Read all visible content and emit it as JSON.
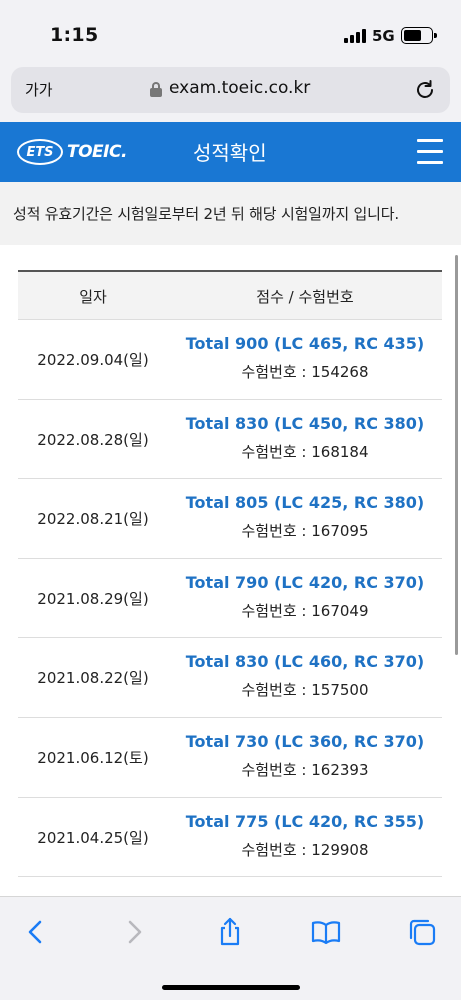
{
  "status_bar": {
    "time": "1:15",
    "network": "5G"
  },
  "address_bar": {
    "text_size_label": "가가",
    "url": "exam.toeic.co.kr"
  },
  "site_header": {
    "logo_ets": "ETS",
    "logo_toeic": "TOEIC.",
    "title": "성적확인",
    "brand_color": "#1977d3"
  },
  "notice": {
    "text": "성적 유효기간은 시험일로부터 2년 뒤 해당 시험일까지 입니다."
  },
  "table": {
    "headers": [
      "일자",
      "점수 / 수험번호"
    ],
    "rows": [
      {
        "date": "2022.09.04(일)",
        "score": "Total 900 (LC 465, RC 435)",
        "exam_no": "수험번호 : 154268"
      },
      {
        "date": "2022.08.28(일)",
        "score": "Total 830 (LC 450, RC 380)",
        "exam_no": "수험번호 : 168184"
      },
      {
        "date": "2022.08.21(일)",
        "score": "Total 805 (LC 425, RC 380)",
        "exam_no": "수험번호 : 167095"
      },
      {
        "date": "2021.08.29(일)",
        "score": "Total 790 (LC 420, RC 370)",
        "exam_no": "수험번호 : 167049"
      },
      {
        "date": "2021.08.22(일)",
        "score": "Total 830 (LC 460, RC 370)",
        "exam_no": "수험번호 : 157500"
      },
      {
        "date": "2021.06.12(토)",
        "score": "Total 730 (LC 360, RC 370)",
        "exam_no": "수험번호 : 162393"
      },
      {
        "date": "2021.04.25(일)",
        "score": "Total 775 (LC 420, RC 355)",
        "exam_no": "수험번호 : 129908"
      }
    ],
    "score_color": "#1f72c4"
  },
  "toolbar": {
    "icons": [
      "back-icon",
      "forward-icon",
      "share-icon",
      "bookmarks-icon",
      "tabs-icon"
    ]
  }
}
